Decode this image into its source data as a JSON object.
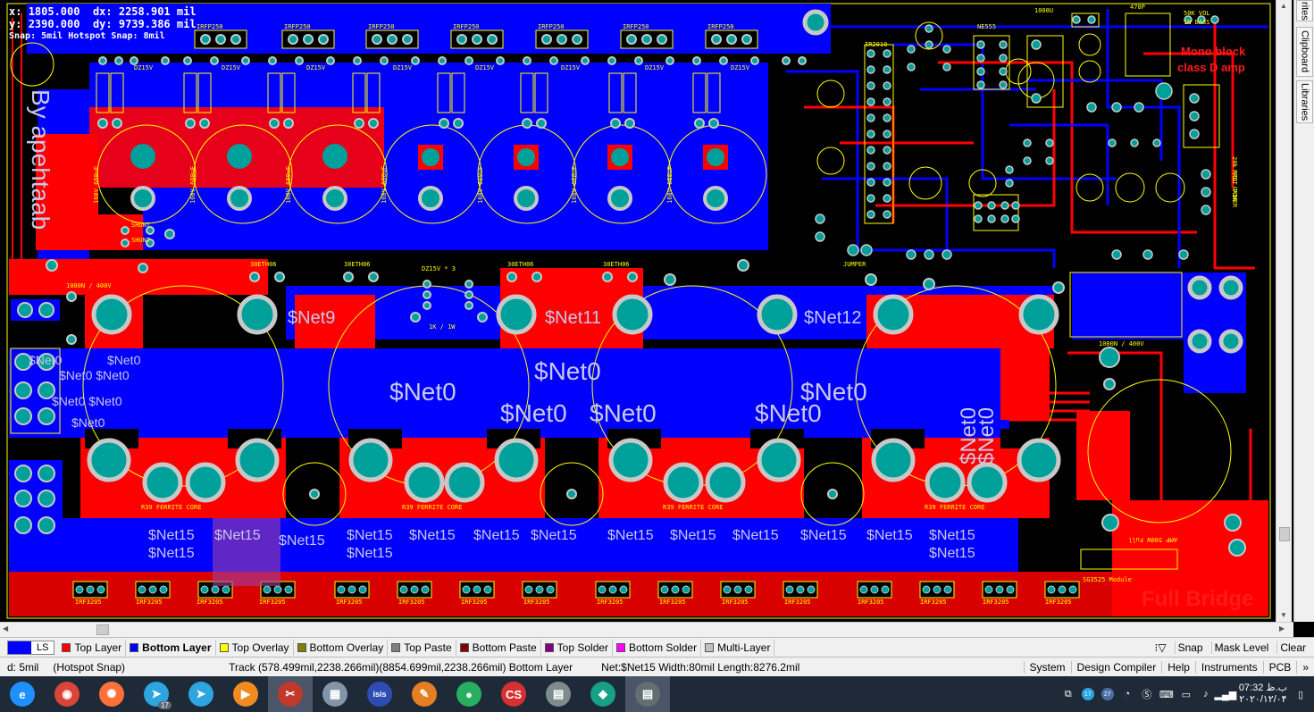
{
  "readout": {
    "x_label": "x:",
    "x_value": "1805.000",
    "dx_label": "dx:",
    "dx_value": "2258.901 mil",
    "y_label": "y:",
    "y_value": "2390.000",
    "dy_label": "dy:",
    "dy_value": "9739.386 mil",
    "snap": "Snap: 5mil Hotspot Snap: 8mil"
  },
  "board": {
    "net_labels_big": [
      "$Net9",
      "$Net11",
      "$Net12",
      "$Net0",
      "$Net0",
      "$Net0",
      "$Net0",
      "$Net0",
      "$Net0"
    ],
    "net15_labels": [
      "$Net15",
      "$Net15",
      "$Net15",
      "$Net15",
      "$Net15",
      "$Net15",
      "$Net15",
      "$Net15",
      "$Net15",
      "$Net15",
      "$Net15",
      "$Net15",
      "$Net15",
      "$Net15",
      "$Net15",
      "$Net15"
    ],
    "left_net0": [
      "$Net0",
      "$Net0",
      "$Net0 $Net0",
      "$Net0 $Net0",
      "$Net0"
    ],
    "vertical_net0": [
      "$Net0",
      "$Net0"
    ],
    "title_mono": "Mono block",
    "title_classd": "class D amp",
    "title_full_bridge": "Full Bridge",
    "title_sg3525": "SG3525 Module",
    "silk_irfp": [
      "IRFP250",
      "IRFP250",
      "IRFP250",
      "IRFP250",
      "IRFP250",
      "IRFP250",
      "IRFP250"
    ],
    "silk_dz": [
      "DZ15V",
      "DZ15V",
      "DZ15V",
      "DZ15V",
      "DZ15V",
      "DZ15V",
      "DZ15V",
      "DZ15V"
    ],
    "silk_caps": [
      "160V 680uF",
      "160V 680uF",
      "160V 680uF",
      "160V 680uF",
      "160V 680uF",
      "160V 680uF",
      "160V 680uF"
    ],
    "silk_ferrite": [
      "R39 FERRITE CORE",
      "R39 FERRITE CORE",
      "R39 FERRITE CORE",
      "R39 FERRITE CORE"
    ],
    "silk_ethos": [
      "30ETH06",
      "30ETH06",
      "30ETH06",
      "30ETH06"
    ],
    "silk_resistor": "1K / 1W",
    "silk_dz3": "DZ15V * 3",
    "silk_jumper": "JUMPER",
    "silk_shunt": [
      "SHUNT",
      "SHUNT"
    ],
    "silk_1000n": "1000N / 400V",
    "silk_1000n2": "1000N / 400V",
    "silk_irf3205": [
      "IRF3205",
      "IRF3205",
      "IRF3205",
      "IRF3205",
      "IRF3205",
      "IRF3205",
      "IRF3205",
      "IRF3205",
      "IRF3205",
      "IRF3205",
      "IRF3205",
      "IRF3205",
      "IRF3205",
      "IRF3205",
      "IRF3205",
      "IRF3205"
    ],
    "silk_ne555": "NE555",
    "silk_ir2010": "IR2010",
    "silk_50k": "50K VOL",
    "silk_bass": "1N BASS",
    "silk_vol_gain": "20k VOL GAIN",
    "silk_prot": "PROT POWER",
    "silk_470p": "470P",
    "silk_1000u": "1000U",
    "silk_bottom_mirror": "AMP 500W Full",
    "silk_left_mirror": "By apehtaab"
  },
  "right_dock": {
    "tabs": [
      "rites",
      "Clipboard",
      "Libraries"
    ]
  },
  "layer_bar": {
    "current_label": "LS",
    "current_color": "#0000ff",
    "tabs": [
      {
        "label": "Top Layer",
        "color": "#ff0000",
        "active": false
      },
      {
        "label": "Bottom Layer",
        "color": "#0000ff",
        "active": true
      },
      {
        "label": "Top Overlay",
        "color": "#ffff00",
        "active": false
      },
      {
        "label": "Bottom Overlay",
        "color": "#808000",
        "active": false
      },
      {
        "label": "Top Paste",
        "color": "#808080",
        "active": false
      },
      {
        "label": "Bottom Paste",
        "color": "#800000",
        "active": false
      },
      {
        "label": "Top Solder",
        "color": "#800080",
        "active": false
      },
      {
        "label": "Bottom Solder",
        "color": "#ff00ff",
        "active": false
      },
      {
        "label": "Multi-Layer",
        "color": "#c0c0c0",
        "active": false
      }
    ],
    "snap": "Snap",
    "mask_level": "Mask Level",
    "clear": "Clear"
  },
  "status_bar": {
    "grid": "d: 5mil",
    "hotspot": "(Hotspot Snap)",
    "track": "Track (578.499mil,2238.266mil)(8854.699mil,2238.266mil)  Bottom Layer",
    "net": "Net:$Net15 Width:80mil Length:8276.2mil",
    "panels": [
      "System",
      "Design Compiler",
      "Help",
      "Instruments",
      "PCB"
    ]
  },
  "taskbar": {
    "apps": [
      {
        "name": "ie",
        "glyph": "e",
        "color": "#1e90ff"
      },
      {
        "name": "chrome",
        "glyph": "◉",
        "color": "#db4437"
      },
      {
        "name": "firefox",
        "glyph": "✺",
        "color": "#ff7139"
      },
      {
        "name": "telegram-1",
        "glyph": "➤",
        "color": "#2ca5e0",
        "badge": "17"
      },
      {
        "name": "telegram-2",
        "glyph": "➤",
        "color": "#2ca5e0"
      },
      {
        "name": "media",
        "glyph": "▶",
        "color": "#f28b20"
      },
      {
        "name": "altium",
        "glyph": "✂",
        "color": "#c0392b",
        "active": true
      },
      {
        "name": "calculator",
        "glyph": "▦",
        "color": "#8395a7"
      },
      {
        "name": "isis",
        "glyph": "isis",
        "color": "#2e4db3"
      },
      {
        "name": "paint",
        "glyph": "✎",
        "color": "#e67e22"
      },
      {
        "name": "pcb-tool",
        "glyph": "●",
        "color": "#27ae60"
      },
      {
        "name": "eagle",
        "glyph": "CS",
        "color": "#d63031"
      },
      {
        "name": "book-1",
        "glyph": "▤",
        "color": "#7f8c8d"
      },
      {
        "name": "map",
        "glyph": "◆",
        "color": "#16a085"
      },
      {
        "name": "book-2",
        "glyph": "▤",
        "color": "#636e72",
        "active": true
      }
    ],
    "tray_badges": [
      "17",
      "27"
    ],
    "time": "07:32 ب.ظ",
    "date": "۲۰۲۰/۱۲/۰۴"
  }
}
